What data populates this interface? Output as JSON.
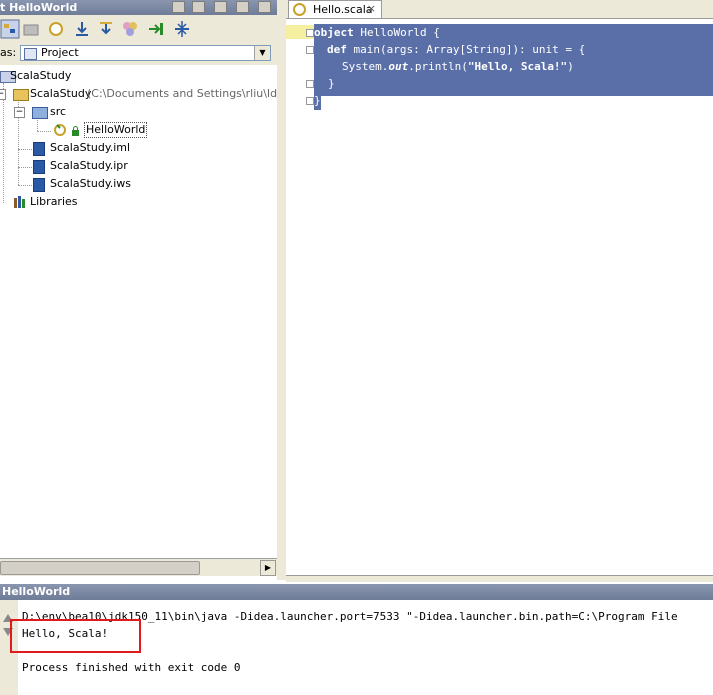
{
  "project_panel": {
    "title": "t  HelloWorld",
    "view_label": "as:",
    "view_value": "Project",
    "tree": [
      {
        "label": "ScalaStudy"
      },
      {
        "label": "ScalaStudy",
        "path": "(C:\\Documents and Settings\\rliu\\IdeaPr"
      },
      {
        "label": "src"
      },
      {
        "label": "HelloWorld"
      },
      {
        "label": "ScalaStudy.iml"
      },
      {
        "label": "ScalaStudy.ipr"
      },
      {
        "label": "ScalaStudy.iws"
      },
      {
        "label": "Libraries"
      }
    ]
  },
  "editor": {
    "tab_label": "Hello.scala",
    "tab_close": "×",
    "code": {
      "l1_kw": "object",
      "l1_rest": " HelloWorld {",
      "l2_kw": "def",
      "l2_rest": " main(args: Array[String]): unit = {",
      "l3_a": "System.",
      "l3_b": "out",
      "l3_c": ".println(",
      "l3_d": "\"Hello, Scala!\"",
      "l3_e": ")",
      "l4": "}",
      "l5": "}"
    }
  },
  "run_panel": {
    "title": "HelloWorld",
    "console": [
      "D:\\env\\bea10\\jdk150_11\\bin\\java -Didea.launcher.port=7533 \"-Didea.launcher.bin.path=C:\\Program File",
      "Hello, Scala!",
      "",
      "Process finished with exit code 0"
    ]
  },
  "colors": {
    "selection": "#5a6fa8",
    "highlight_box": "#e01b1b"
  }
}
